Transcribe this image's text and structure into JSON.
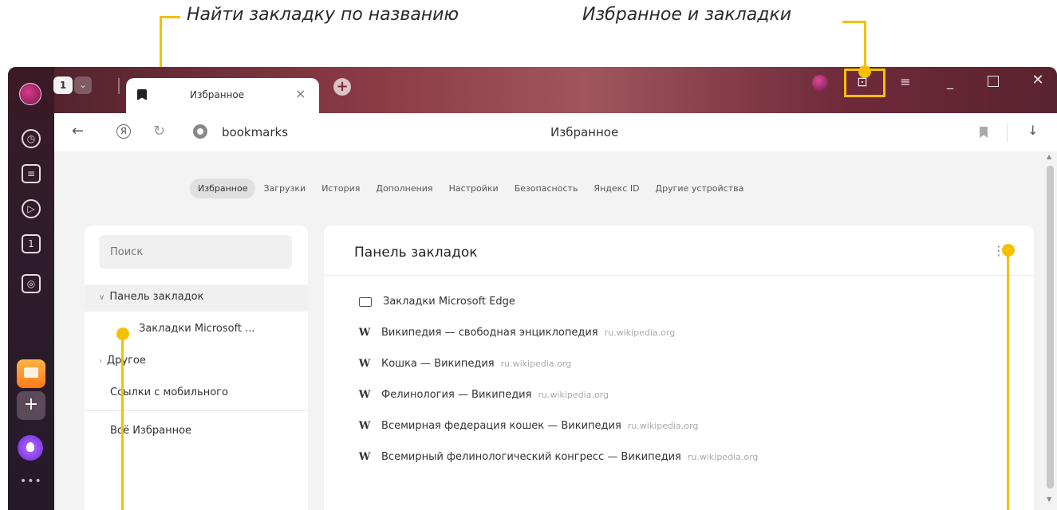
{
  "annotations": {
    "find_by_name": "Найти закладку по названию",
    "favorites_and_bookmarks": "Избранное и закладки"
  },
  "colors": {
    "accent": "#f5c000",
    "titlebar": "#8c3b45",
    "sidebar": "#2e1c2a"
  },
  "sidebar": {
    "icons": [
      "history-icon",
      "collections-icon",
      "play-icon",
      "tab-counter-icon",
      "screenshot-icon"
    ],
    "tab_counter_value": "1",
    "apps": [
      "mail-app",
      "add-app",
      "alice-app",
      "more-icon"
    ],
    "more_label": "•••"
  },
  "tabbar": {
    "tab_count": "1",
    "active_tab_title": "Избранное",
    "close_glyph": "×",
    "new_tab_glyph": "+"
  },
  "addressbar": {
    "back_glyph": "←",
    "yandex_glyph": "Я",
    "reload_glyph": "↻",
    "url": "bookmarks",
    "page_title": "Избранное",
    "download_glyph": "↓"
  },
  "settings_nav": {
    "items": [
      "Избранное",
      "Загрузки",
      "История",
      "Дополнения",
      "Настройки",
      "Безопасность",
      "Яндекс ID",
      "Другие устройства"
    ],
    "active_index": 0
  },
  "left_panel": {
    "search_placeholder": "Поиск",
    "tree": {
      "root": "Панель закладок",
      "child": "Закладки Microsoft ...",
      "other": "Другое",
      "mobile": "Ссылки с мобильного",
      "all": "Всё Избранное"
    }
  },
  "right_panel": {
    "title": "Панель закладок",
    "menu_glyph": "⋮",
    "folder": "Закладки Microsoft Edge",
    "bookmarks": [
      {
        "icon": "W",
        "title": "Википедия — свободная энциклопедия",
        "url": "ru.wikipedia.org"
      },
      {
        "icon": "W",
        "title": "Кошка — Википедия",
        "url": "ru.wikipedia.org"
      },
      {
        "icon": "W",
        "title": "Фелинология — Википедия",
        "url": "ru.wikipedia.org"
      },
      {
        "icon": "W",
        "title": "Всемирная федерация кошек — Википедия",
        "url": "ru.wikipedia.org"
      },
      {
        "icon": "W",
        "title": "Всемирный фелинологический конгресс — Википедия",
        "url": "ru.wikipedia.org"
      }
    ]
  }
}
